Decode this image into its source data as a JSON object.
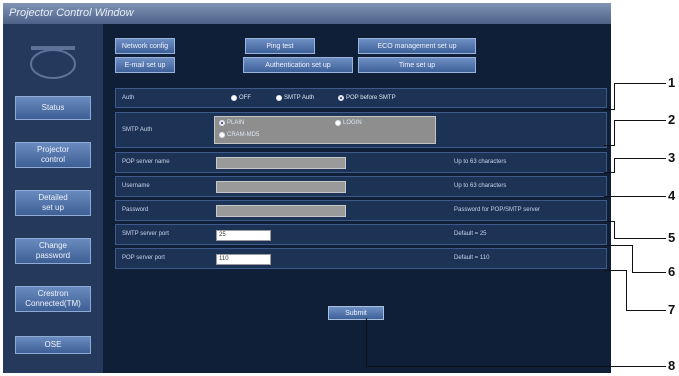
{
  "window_title": "Projector Control Window",
  "sidebar": {
    "items": [
      {
        "label": "Status"
      },
      {
        "label": "Projector\ncontrol"
      },
      {
        "label": "Detailed\nset up"
      },
      {
        "label": "Change\npassword"
      },
      {
        "label": "Crestron\nConnected(TM)"
      },
      {
        "label": "OSE"
      }
    ]
  },
  "tabs": {
    "network_config": "Network config",
    "ping_test": "Ping test",
    "eco_management": "ECO management set up",
    "email_set_up": "E-mail set up",
    "authentication_set_up": "Authentication set up",
    "time_set_up": "Time set up"
  },
  "form": {
    "auth": {
      "label": "Auth",
      "options": [
        "OFF",
        "SMTP Auth",
        "POP before SMTP"
      ],
      "selected": "POP before SMTP"
    },
    "smtp_auth": {
      "label": "SMTP Auth",
      "options": [
        "PLAIN",
        "LOGIN",
        "CRAM-MD5"
      ],
      "selected": "PLAIN"
    },
    "pop_server_name": {
      "label": "POP server name",
      "note": "Up to 63 characters"
    },
    "username": {
      "label": "Username",
      "note": "Up to 63 characters"
    },
    "password": {
      "label": "Password",
      "note": "Password for POP/SMTP server"
    },
    "smtp_server_port": {
      "label": "SMTP server port",
      "value": "25",
      "note": "Default = 25"
    },
    "pop_server_port": {
      "label": "POP server port",
      "value": "110",
      "note": "Default = 110"
    }
  },
  "submit_label": "Submit",
  "callouts": [
    "1",
    "2",
    "3",
    "4",
    "5",
    "6",
    "7",
    "8"
  ]
}
